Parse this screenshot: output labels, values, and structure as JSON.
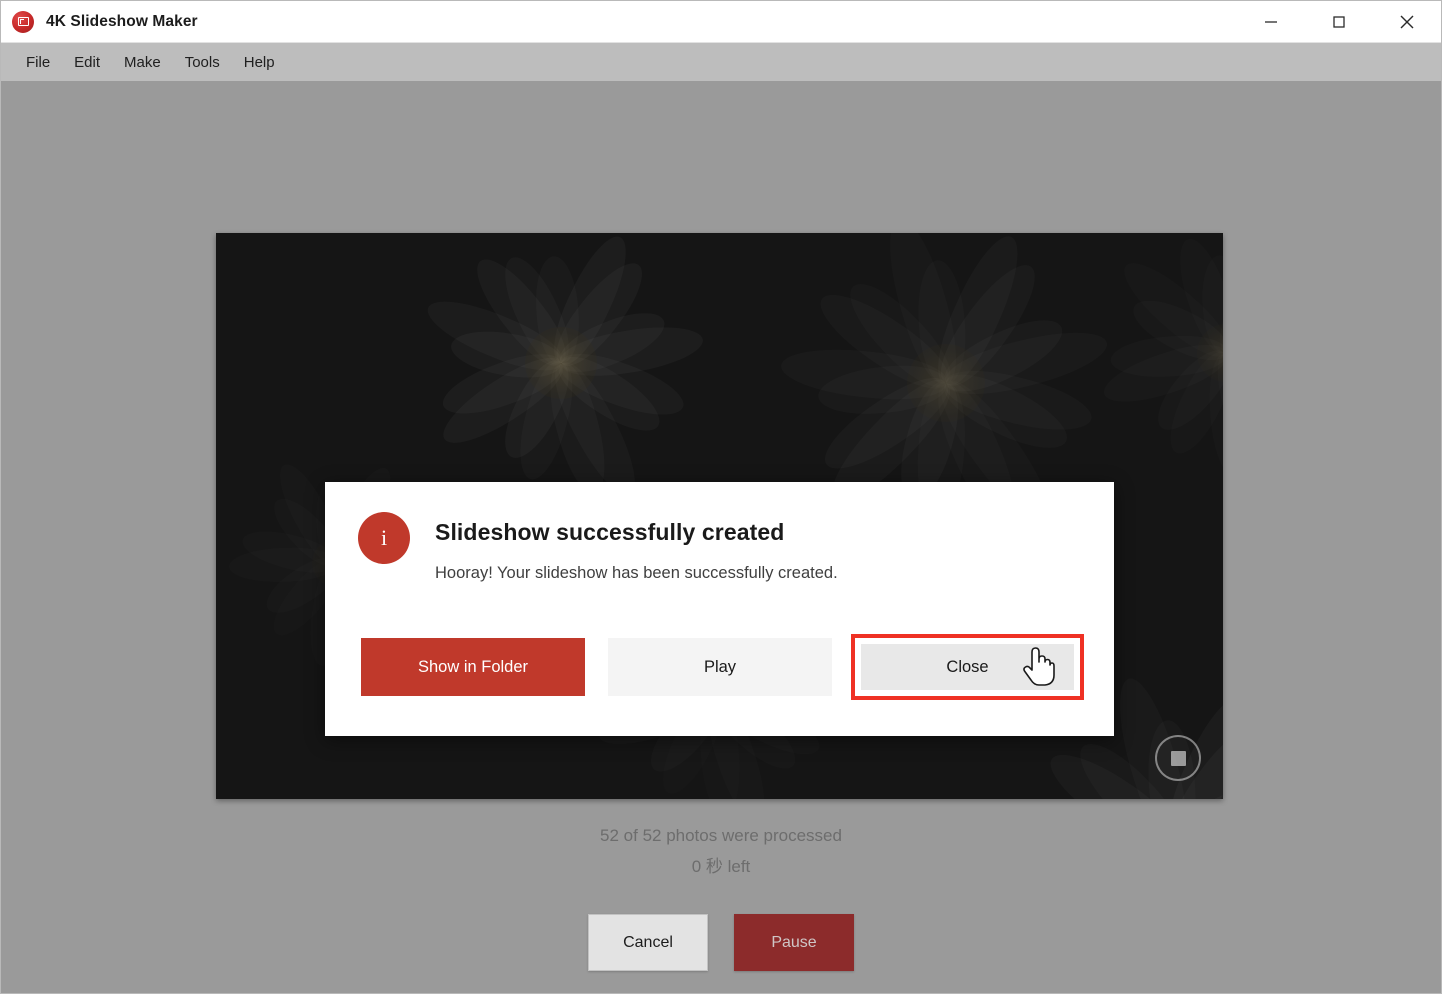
{
  "window": {
    "title": "4K Slideshow Maker",
    "logo_icon": "app-logo-icon",
    "controls": {
      "minimize": "minimize-icon",
      "maximize": "maximize-icon",
      "close": "close-icon"
    }
  },
  "menubar": {
    "items": [
      {
        "label": "File"
      },
      {
        "label": "Edit"
      },
      {
        "label": "Make"
      },
      {
        "label": "Tools"
      },
      {
        "label": "Help"
      }
    ]
  },
  "preview": {
    "stop_icon": "stop-icon",
    "background_description": "dark daisy flowers"
  },
  "status": {
    "processed": "52 of 52 photos were processed",
    "time_left": "0 秒 left"
  },
  "bottom_buttons": {
    "cancel": "Cancel",
    "pause": "Pause"
  },
  "dialog": {
    "icon": "info-icon",
    "title": "Slideshow successfully created",
    "message": "Hooray! Your slideshow has been successfully created.",
    "buttons": {
      "show_in_folder": "Show in Folder",
      "play": "Play",
      "close": "Close"
    }
  },
  "colors": {
    "brand_red": "#c0392b",
    "highlight_red": "#ef3124",
    "pause_red": "#8c2b2b",
    "window_bg": "#9a9a9a",
    "menubar_bg": "#bdbdbd",
    "preview_bg": "#161616"
  },
  "cursor": {
    "type": "pointing-hand"
  }
}
